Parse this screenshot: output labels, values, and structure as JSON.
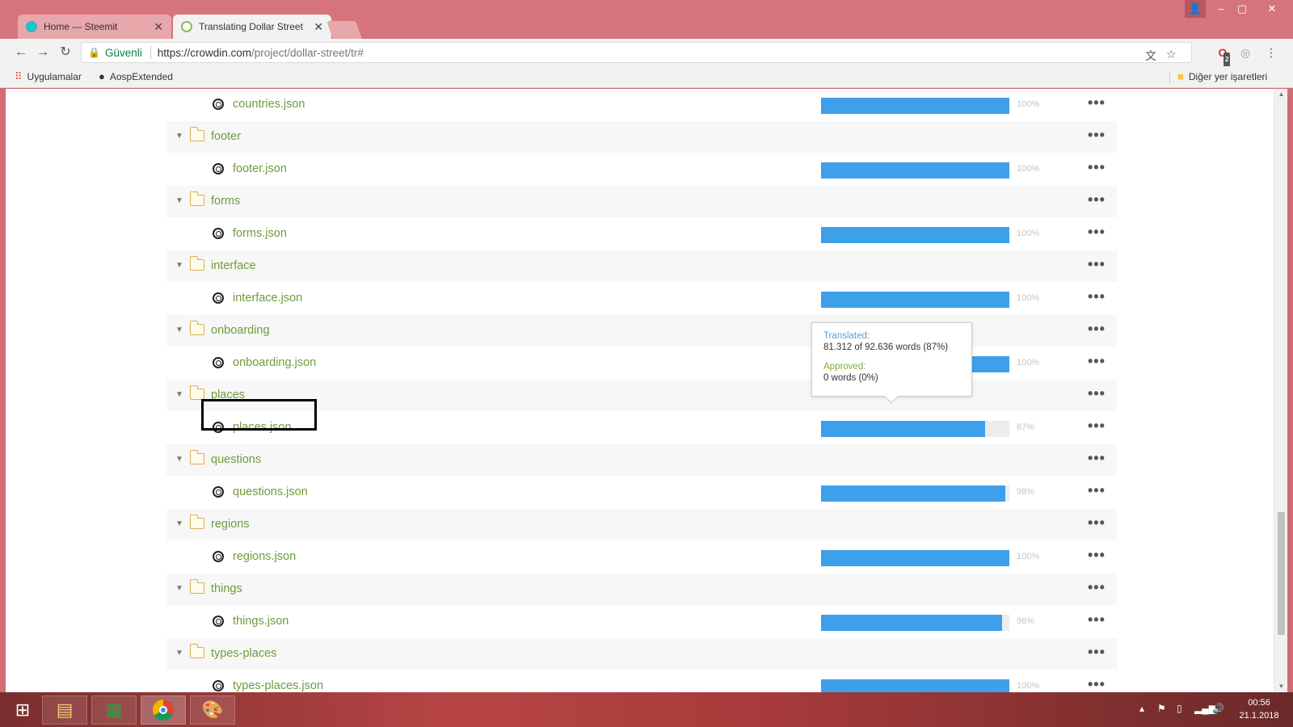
{
  "browser": {
    "tabs": [
      {
        "title": "Home — Steemit",
        "active": false
      },
      {
        "title": "Translating Dollar Street",
        "active": true
      }
    ],
    "address": {
      "secure_label": "Güvenli",
      "url_host": "https://crowdin.com",
      "url_path": "/project/dollar-street/tr#"
    },
    "bookmarks": {
      "apps": "Uygulamalar",
      "aosp": "AospExtended",
      "other": "Diğer yer işaretleri"
    },
    "extension_badge": "2"
  },
  "files": [
    {
      "kind": "file",
      "name": "countries.json",
      "progress": 100,
      "pct": "100%"
    },
    {
      "kind": "folder",
      "name": "footer"
    },
    {
      "kind": "file",
      "name": "footer.json",
      "progress": 100,
      "pct": "100%"
    },
    {
      "kind": "folder",
      "name": "forms"
    },
    {
      "kind": "file",
      "name": "forms.json",
      "progress": 100,
      "pct": "100%"
    },
    {
      "kind": "folder",
      "name": "interface"
    },
    {
      "kind": "file",
      "name": "interface.json",
      "progress": 100,
      "pct": "100%"
    },
    {
      "kind": "folder",
      "name": "onboarding"
    },
    {
      "kind": "file",
      "name": "onboarding.json",
      "progress": 100,
      "pct": "100%"
    },
    {
      "kind": "folder",
      "name": "places"
    },
    {
      "kind": "file",
      "name": "places.json",
      "progress": 87,
      "pct": "87%"
    },
    {
      "kind": "folder",
      "name": "questions"
    },
    {
      "kind": "file",
      "name": "questions.json",
      "progress": 98,
      "pct": "98%"
    },
    {
      "kind": "folder",
      "name": "regions"
    },
    {
      "kind": "file",
      "name": "regions.json",
      "progress": 100,
      "pct": "100%"
    },
    {
      "kind": "folder",
      "name": "things"
    },
    {
      "kind": "file",
      "name": "things.json",
      "progress": 96,
      "pct": "96%"
    },
    {
      "kind": "folder",
      "name": "types-places"
    },
    {
      "kind": "file",
      "name": "types-places.json",
      "progress": 100,
      "pct": "100%"
    }
  ],
  "tooltip": {
    "translated_label": "Translated:",
    "translated_value": "81.312 of 92.636 words (87%)",
    "approved_label": "Approved:",
    "approved_value": "0 words (0%)"
  },
  "taskbar": {
    "time": "00:56",
    "date": "21.1.2018"
  },
  "colors": {
    "progress": "#3e9fea",
    "file_name": "#6f9b3e",
    "chrome_frame": "#d6747b"
  }
}
